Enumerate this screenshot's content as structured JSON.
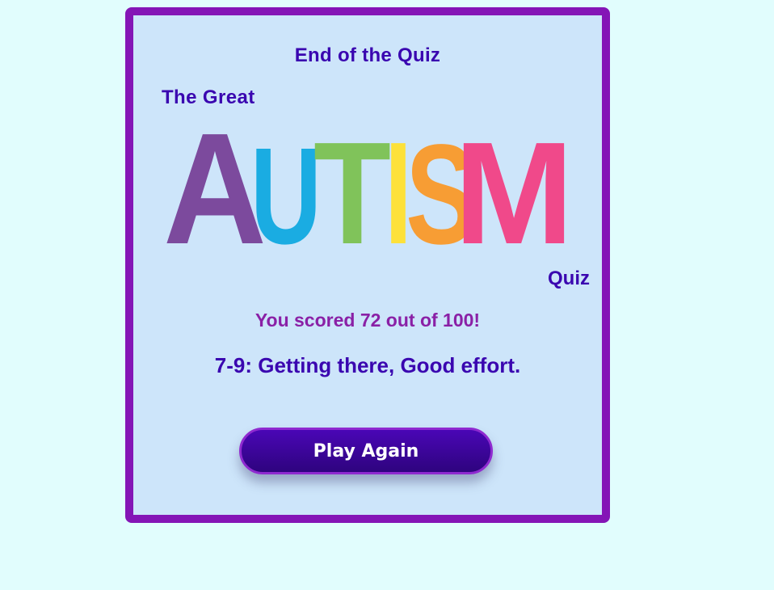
{
  "quiz": {
    "heading": "End of the Quiz",
    "logo": {
      "pre_text": "The Great",
      "word_letters": [
        {
          "char": "A",
          "color": "#7c4a9d"
        },
        {
          "char": "U",
          "color": "#1aace2"
        },
        {
          "char": "T",
          "color": "#80c35a"
        },
        {
          "char": "I",
          "color": "#fde13a"
        },
        {
          "char": "S",
          "color": "#f79d34"
        },
        {
          "char": "M",
          "color": "#f0498a"
        }
      ],
      "post_text": "Quiz"
    },
    "score_text": "You scored 72 out of 100!",
    "verdict_text": "7-9: Getting there, Good effort.",
    "play_again_label": "Play Again"
  },
  "colors": {
    "page_background": "#e1fdfd",
    "card_background": "#cde5fa",
    "card_border": "#8415b6",
    "heading_text": "#3a06b0",
    "score_text": "#8a20a6",
    "button_background": "#3a06a0"
  }
}
